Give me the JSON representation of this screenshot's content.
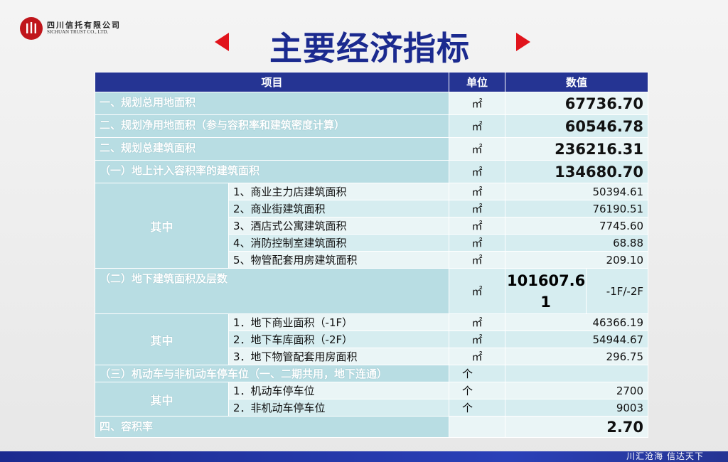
{
  "logo": {
    "cn": "四川信托有限公司",
    "en": "SICHUAN TRUST CO., LTD."
  },
  "title": "主要经济指标",
  "headers": {
    "item": "项目",
    "unit": "单位",
    "value": "数值"
  },
  "rows": {
    "r1": {
      "label": "一、规划总用地面积",
      "unit": "㎡",
      "value": "67736.70"
    },
    "r2": {
      "label": "二、规划净用地面积（参与容积率和建筑密度计算）",
      "unit": "㎡",
      "value": "60546.78"
    },
    "r3": {
      "label": "二、规划总建筑面积",
      "unit": "㎡",
      "value": "236216.31"
    },
    "r4": {
      "label": "（一）地上计入容积率的建筑面积",
      "unit": "㎡",
      "value": "134680.70"
    },
    "g1": {
      "label": "其中",
      "items": [
        {
          "name": "1、商业主力店建筑面积",
          "unit": "㎡",
          "value": "50394.61"
        },
        {
          "name": "2、商业街建筑面积",
          "unit": "㎡",
          "value": "76190.51"
        },
        {
          "name": "3、酒店式公寓建筑面积",
          "unit": "㎡",
          "value": "7745.60"
        },
        {
          "name": "4、消防控制室建筑面积",
          "unit": "㎡",
          "value": "68.88"
        },
        {
          "name": "5、物管配套用房建筑面积",
          "unit": "㎡",
          "value": "209.10"
        }
      ]
    },
    "r5": {
      "label": "（二）地下建筑面积及层数",
      "unit": "㎡",
      "value_l1": "101607.6",
      "value_l2": "1",
      "floors": "-1F/-2F"
    },
    "g2": {
      "label": "其中",
      "items": [
        {
          "name": "1．地下商业面积（-1F）",
          "unit": "㎡",
          "value": "46366.19"
        },
        {
          "name": "2．地下车库面积（-2F）",
          "unit": "㎡",
          "value": "54944.67"
        },
        {
          "name": "3．地下物管配套用房面积",
          "unit": "㎡",
          "value": "296.75"
        }
      ]
    },
    "r6": {
      "label": "（三）机动车与非机动车停车位（一、二期共用，地下连通）",
      "unit": "个"
    },
    "g3": {
      "label": "其中",
      "items": [
        {
          "name": "1．机动车停车位",
          "unit": "个",
          "value": "2700"
        },
        {
          "name": "2．非机动车停车位",
          "unit": "个",
          "value": "9003"
        }
      ]
    },
    "r7": {
      "label": "四、容积率",
      "value": "2.70"
    }
  },
  "footer": {
    "slogan": "川汇沧海    信达天下"
  },
  "colors": {
    "header": "#253493",
    "label": "#b8dde3",
    "title": "#1b2a8f",
    "arrow": "#e1141c",
    "logo": "#c0161c"
  }
}
